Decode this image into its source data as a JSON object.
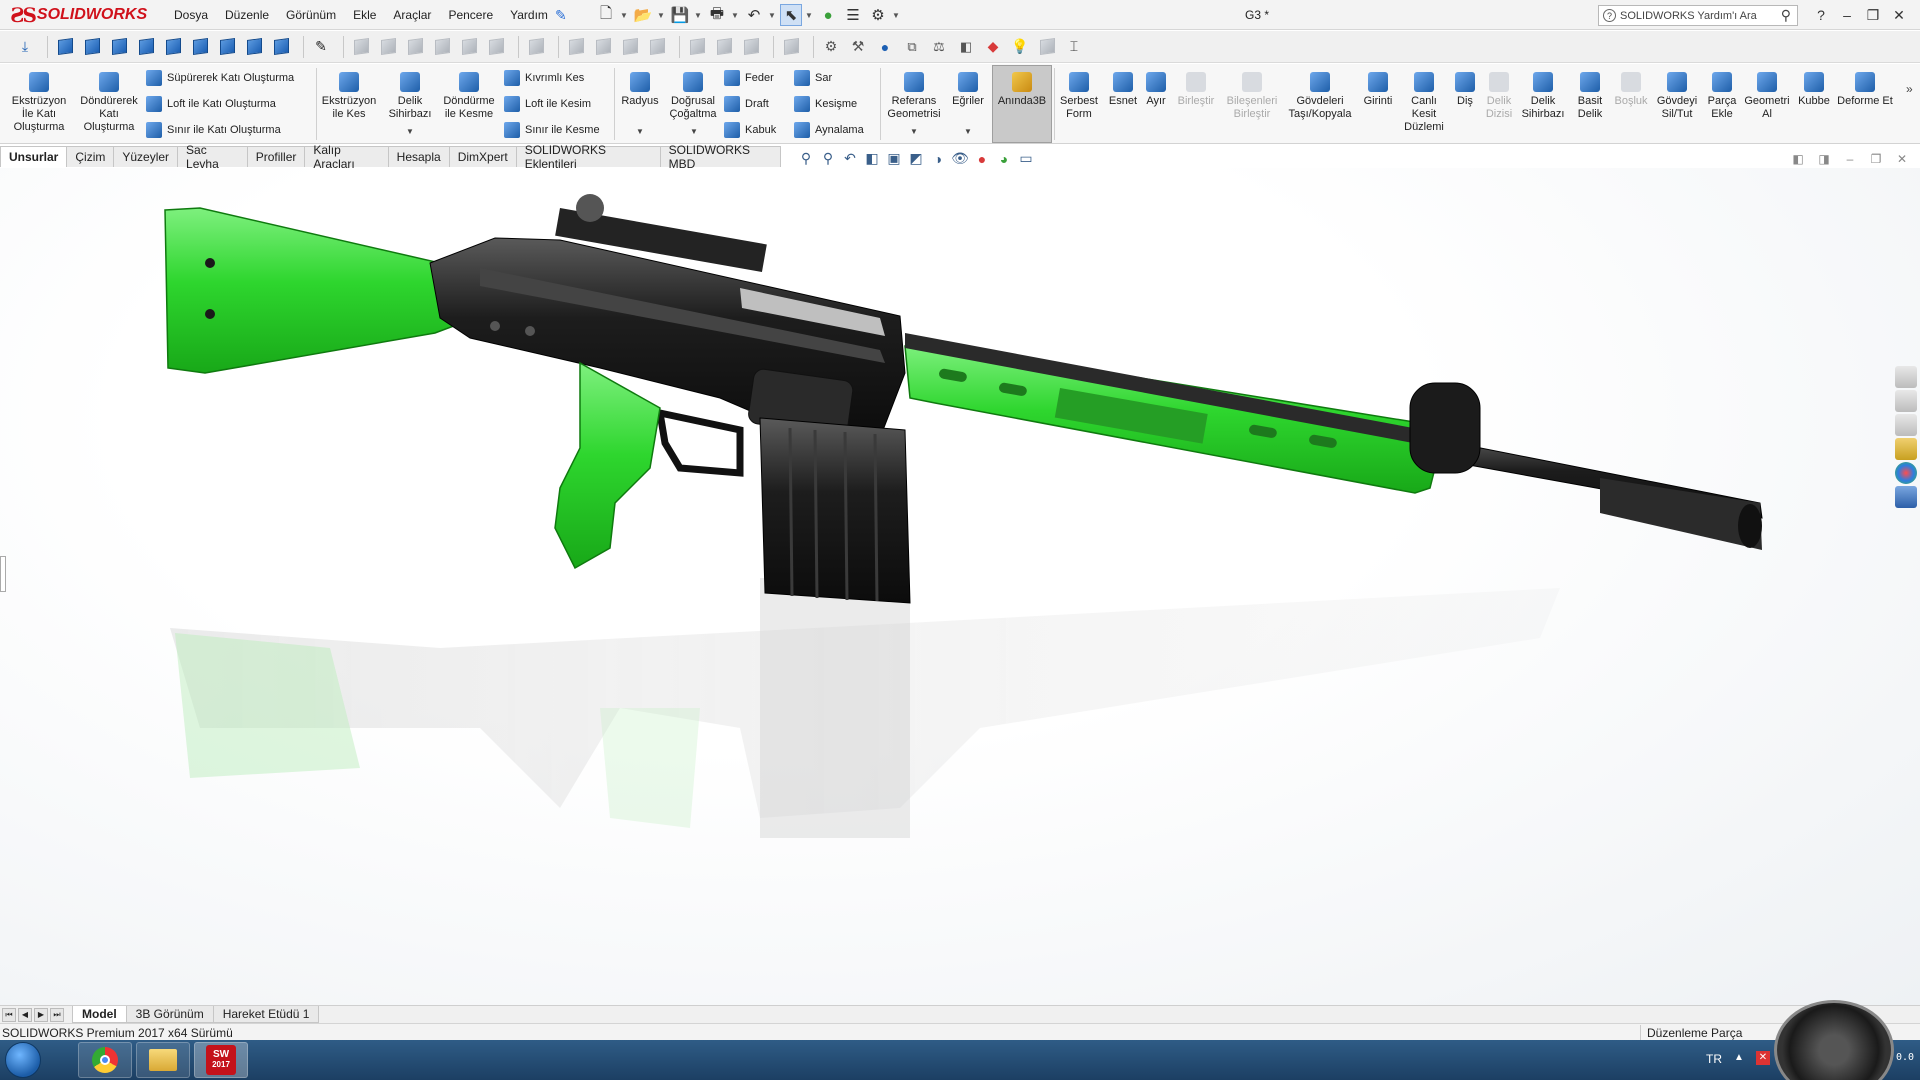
{
  "app": {
    "brand": "SOLIDWORKS",
    "document_title": "G3 *"
  },
  "menu": [
    "Dosya",
    "Düzenle",
    "Görünüm",
    "Ekle",
    "Araçlar",
    "Pencere",
    "Yardım"
  ],
  "help_search": {
    "placeholder": "SOLIDWORKS Yardım'ı Ara"
  },
  "command_manager": {
    "extrude_boss": "Ekstrüzyon İle Katı Oluşturma",
    "revolve_boss": "Döndürerek Katı Oluşturma",
    "sweep_boss": "Süpürerek Katı Oluşturma",
    "loft_boss": "Loft ile Katı Oluşturma",
    "boundary_boss": "Sınır ile Katı Oluşturma",
    "extrude_cut": "Ekstrüzyon ile Kes",
    "hole_wizard": "Delik Sihirbazı",
    "revolve_cut": "Döndürme ile Kesme",
    "swept_cut": "Kıvrımlı Kes",
    "loft_cut": "Loft ile Kesim",
    "boundary_cut": "Sınır ile Kesme",
    "fillet": "Radyus",
    "linear_pattern": "Doğrusal Çoğaltma",
    "rib": "Feder",
    "draft": "Draft",
    "shell": "Kabuk",
    "wrap": "Sar",
    "intersect": "Kesişme",
    "mirror": "Aynalama",
    "reference_geometry": "Referans Geometrisi",
    "curves": "Eğriler",
    "instant3d": "Anında3B",
    "free_form": "Serbest Form",
    "flex": "Esnet",
    "split": "Ayır",
    "combine": "Birleştir",
    "join_components": "Bileşenleri Birleştir",
    "move_copy_bodies": "Gövdeleri Taşı/Kopyala",
    "indent": "Girinti",
    "live_section": "Canlı Kesit Düzlemi",
    "thread": "Diş",
    "hole_series": "Delik Dizisi",
    "hole_wizard2": "Delik Sihirbazı",
    "simple_hole": "Basit Delik",
    "cavity": "Boşluk",
    "delete_keep_body": "Gövdeyi Sil/Tut",
    "insert_part": "Parça Ekle",
    "import_geometry": "Geometri Al",
    "dome": "Kubbe",
    "deform": "Deforme Et"
  },
  "tabs": [
    "Unsurlar",
    "Çizim",
    "Yüzeyler",
    "Sac Levha",
    "Profiller",
    "Kalıp Araçları",
    "Hesapla",
    "DimXpert",
    "SOLIDWORKS Eklentileri",
    "SOLIDWORKS MBD"
  ],
  "active_tab": "Unsurlar",
  "bottom_tabs": [
    "Model",
    "3B Görünüm",
    "Hareket Etüdü 1"
  ],
  "status": {
    "version": "SOLIDWORKS Premium 2017 x64 Sürümü",
    "mode": "Düzenleme Parça"
  },
  "taskbar": {
    "language": "TR",
    "sw_badge": "2017",
    "gauge_value": "0.0"
  },
  "colors": {
    "accent_red": "#d0111b",
    "stock_green": "#2fd62f",
    "body_black": "#1f1f1f"
  },
  "icons": {
    "close": "close-icon",
    "help": "help-icon",
    "search": "search-icon"
  }
}
